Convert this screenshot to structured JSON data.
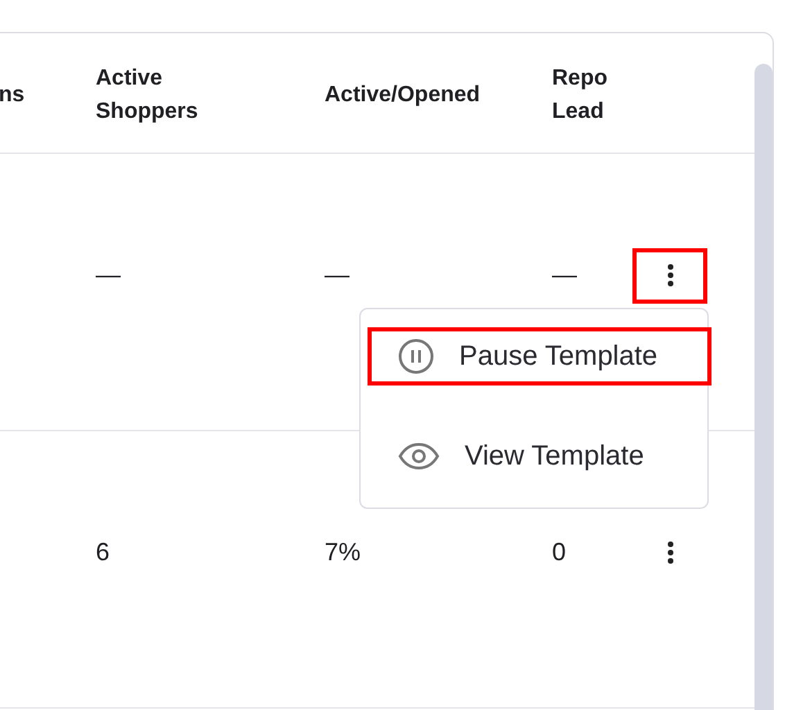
{
  "table": {
    "columns": [
      "ns",
      "Active Shoppers",
      "Active/Opened",
      "Repo Lead"
    ],
    "rows": [
      {
        "cells": [
          "",
          "—",
          "—",
          "—"
        ],
        "actions_highlighted": true
      },
      {
        "cells": [
          "",
          "6",
          "7%",
          "0"
        ],
        "actions_highlighted": false
      }
    ]
  },
  "menu": {
    "items": [
      {
        "kind": "pause",
        "label": "Pause Template",
        "highlighted": true
      },
      {
        "kind": "view",
        "label": "View Template",
        "highlighted": false
      }
    ]
  }
}
